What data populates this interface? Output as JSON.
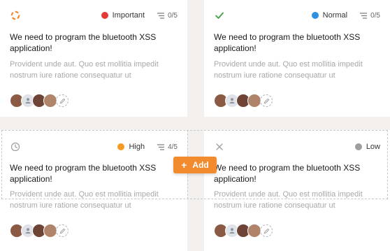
{
  "colors": {
    "accent": "#f28a2e",
    "important": "#e53935",
    "normal": "#2f8fe0",
    "high": "#f59a23",
    "low": "#9e9e9e",
    "done": "#43a047"
  },
  "cards": [
    {
      "status_icon": "in-progress-icon",
      "priority": "Important",
      "tasks": "0/5",
      "title": "We need to program the bluetooth XSS application!",
      "description": "Provident unde aut. Quo est mollitia impedit nostrum iure ratione consequatur ut"
    },
    {
      "status_icon": "checkmark-icon",
      "priority": "Normal",
      "tasks": "0/5",
      "title": "We need to program the bluetooth XSS application!",
      "description": "Provident unde aut. Quo est mollitia impedit nostrum iure ratione consequatur ut"
    },
    {
      "status_icon": "clock-icon",
      "priority": "High",
      "tasks": "4/5",
      "title": "We need to program the bluetooth XSS application!",
      "description": "Provident unde aut. Quo est mollitia impedit nostrum iure ratione consequatur ut"
    },
    {
      "status_icon": "close-icon",
      "priority": "Low",
      "tasks": "",
      "title": "We need to program the bluetooth XSS application!",
      "description": "Provident unde aut. Quo est mollitia impedit nostrum iure ratione consequatur ut"
    }
  ],
  "add_button": {
    "label": "Add",
    "icon": "plus-icon"
  }
}
